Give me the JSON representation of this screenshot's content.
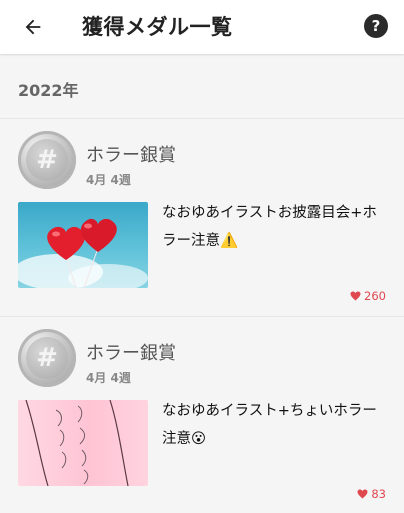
{
  "header": {
    "title": "獲得メダル一覧",
    "help_label": "?"
  },
  "year": "2022年",
  "awards": [
    {
      "name": "ホラー銀賞",
      "date": "4月 4週",
      "post_title": "なおゆあイラストお披露目会+ホラー注意⚠️",
      "likes": "260",
      "thumb_icon": "heart-balloons-image"
    },
    {
      "name": "ホラー銀賞",
      "date": "4月 4週",
      "post_title": "なおゆあイラスト+ちょいホラー注意😮",
      "likes": "83",
      "thumb_icon": "pink-sketch-image"
    }
  ],
  "colors": {
    "like": "#e0484f",
    "background": "#f5f5f6"
  }
}
